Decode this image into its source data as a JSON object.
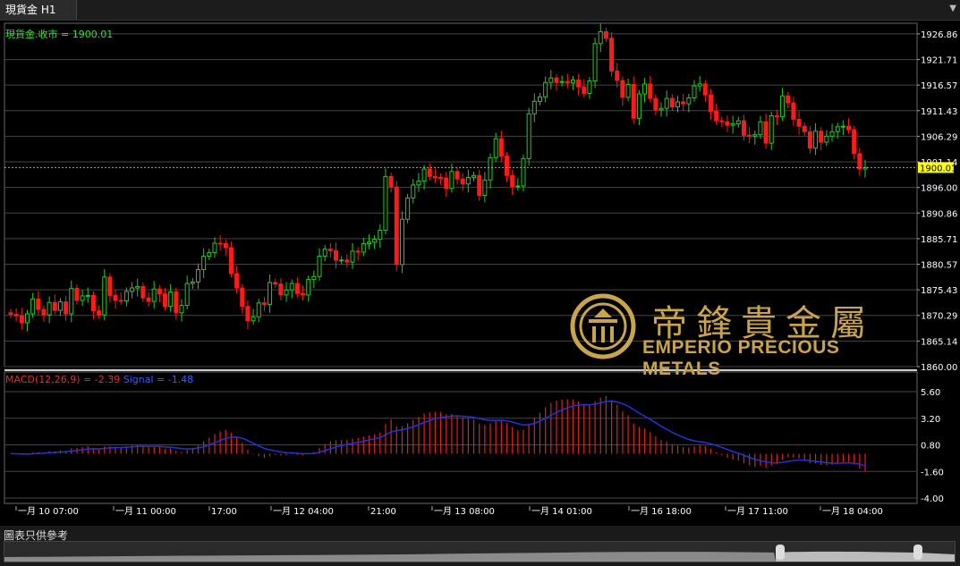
{
  "tab": {
    "label": "現貨金 H1"
  },
  "price_legend": "現貨金.收市 = 1900.01",
  "macd_legend": {
    "macd": "MACD(12,26,9) = -2.39",
    "signal": "Signal = -1.48"
  },
  "current_price_label": "1900.01",
  "logo": {
    "cn": "帝鋒貴金屬",
    "en": "EMPERIO PRECIOUS METALS"
  },
  "footer_note": "圖表只供參考",
  "colors": {
    "up": "#22cc22",
    "down": "#ff1a1a",
    "signal": "#2233dd",
    "grid": "#444444",
    "price_line": "#d9a441",
    "label_bg": "#ffff00"
  },
  "chart_data": {
    "type": "candlestick",
    "price_axis": {
      "ticks": [
        "1926.86",
        "1921.71",
        "1916.57",
        "1911.43",
        "1906.29",
        "1901.14",
        "1896.00",
        "1890.86",
        "1885.71",
        "1880.57",
        "1875.43",
        "1870.29",
        "1865.14",
        "1860.00"
      ],
      "range": [
        1860.0,
        1929.0
      ]
    },
    "macd_axis": {
      "ticks": [
        "5.60",
        "3.20",
        "0.80",
        "-1.60",
        "-4.00"
      ],
      "range": [
        -4.0,
        5.6
      ]
    },
    "time_labels": [
      "一月 10 07:00",
      "一月 11 00:00",
      "17:00",
      "一月 12 04:00",
      "21:00",
      "一月 13 08:00",
      "一月 14 01:00",
      "一月 16 18:00",
      "一月 17 11:00",
      "一月 18 04:00"
    ],
    "current_price": 1900.01,
    "macd_current": -2.39,
    "signal_current": -1.48,
    "closes": [
      1870.5,
      1870.2,
      1868.8,
      1870.6,
      1873.6,
      1871.5,
      1870.4,
      1872.9,
      1871.3,
      1873.0,
      1870.6,
      1875.7,
      1873.3,
      1874.2,
      1874.3,
      1871.2,
      1870.4,
      1878.0,
      1874.3,
      1873.3,
      1873.2,
      1875.1,
      1875.8,
      1876.1,
      1873.8,
      1873.1,
      1875.6,
      1874.6,
      1872.1,
      1875.0,
      1870.8,
      1872.3,
      1876.7,
      1877.0,
      1879.5,
      1882.2,
      1882.9,
      1884.8,
      1884.7,
      1883.9,
      1878.7,
      1875.8,
      1872.1,
      1869.2,
      1870.0,
      1872.8,
      1872.5,
      1876.9,
      1876.6,
      1874.4,
      1875.4,
      1876.7,
      1874.7,
      1874.4,
      1877.5,
      1878.1,
      1882.2,
      1883.6,
      1883.3,
      1881.4,
      1881.4,
      1881.0,
      1883.2,
      1883.0,
      1884.7,
      1885.0,
      1885.6,
      1887.4,
      1898.2,
      1896.1,
      1880.5,
      1889.6,
      1893.9,
      1896.5,
      1897.3,
      1899.7,
      1898.2,
      1898.0,
      1897.9,
      1895.8,
      1899.2,
      1897.7,
      1896.7,
      1898.0,
      1898.4,
      1894.4,
      1897.5,
      1902.0,
      1905.8,
      1902.3,
      1898.4,
      1896.2,
      1896.3,
      1901.8,
      1910.8,
      1913.3,
      1914.2,
      1917.1,
      1918.0,
      1917.1,
      1917.3,
      1917.0,
      1917.6,
      1916.2,
      1914.9,
      1917.4,
      1924.9,
      1927.3,
      1926.0,
      1919.4,
      1917.5,
      1914.1,
      1916.7,
      1909.9,
      1914.8,
      1916.8,
      1913.9,
      1911.6,
      1911.9,
      1913.9,
      1912.2,
      1913.2,
      1912.8,
      1914.0,
      1916.4,
      1916.8,
      1914.6,
      1911.3,
      1909.4,
      1909.2,
      1908.5,
      1908.8,
      1909.4,
      1906.5,
      1906.3,
      1906.6,
      1909.2,
      1904.9,
      1910.4,
      1910.2,
      1914.4,
      1913.0,
      1909.7,
      1908.3,
      1907.2,
      1903.9,
      1907.3,
      1905.1,
      1906.3,
      1907.2,
      1908.2,
      1908.3,
      1907.6,
      1902.8,
      1899.7,
      1900.0
    ]
  }
}
